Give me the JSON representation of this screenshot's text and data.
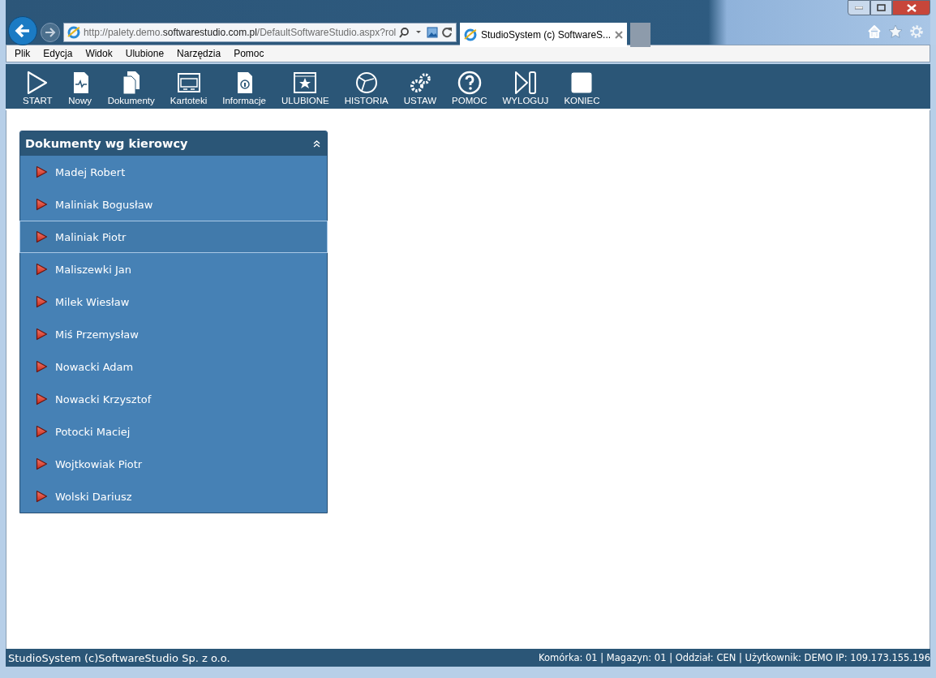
{
  "browser": {
    "url": {
      "prefix": "http://palety.demo.",
      "domain": "softwarestudio.com.pl",
      "suffix": "/DefaultSoftwareStudio.aspx?rol"
    },
    "tabs": [
      {
        "title": "StudioSystem (c) SoftwareS...",
        "selected": true
      }
    ],
    "menu": [
      "Plik",
      "Edycja",
      "Widok",
      "Ulubione",
      "Narzędzia",
      "Pomoc"
    ]
  },
  "toolbar": [
    "START",
    "Nowy",
    "Dokumenty",
    "Kartoteki",
    "Informacje",
    "ULUBIONE",
    "HISTORIA",
    "USTAW",
    "POMOC",
    "WYLOGUJ",
    "KONIEC"
  ],
  "panel": {
    "title": "Dokumenty wg kierowcy",
    "expanded": true,
    "items": [
      {
        "label": "Madej Robert",
        "selected": false
      },
      {
        "label": "Maliniak Bogusław",
        "selected": false
      },
      {
        "label": "Maliniak Piotr",
        "selected": true
      },
      {
        "label": "Maliszewki Jan",
        "selected": false
      },
      {
        "label": "Milek Wiesław",
        "selected": false
      },
      {
        "label": "Miś Przemysław",
        "selected": false
      },
      {
        "label": "Nowacki Adam",
        "selected": false
      },
      {
        "label": "Nowacki Krzysztof",
        "selected": false
      },
      {
        "label": "Potocki Maciej",
        "selected": false
      },
      {
        "label": "Wojtkowiak Piotr",
        "selected": false
      },
      {
        "label": "Wolski Dariusz",
        "selected": false
      }
    ]
  },
  "status_bar": {
    "left": "StudioSystem (c)SoftwareStudio Sp. z o.o.",
    "right": "Komórka: 01 | Magazyn: 01 | Oddział: CEN | Użytkownik: DEMO IP: 109.173.155.196"
  }
}
